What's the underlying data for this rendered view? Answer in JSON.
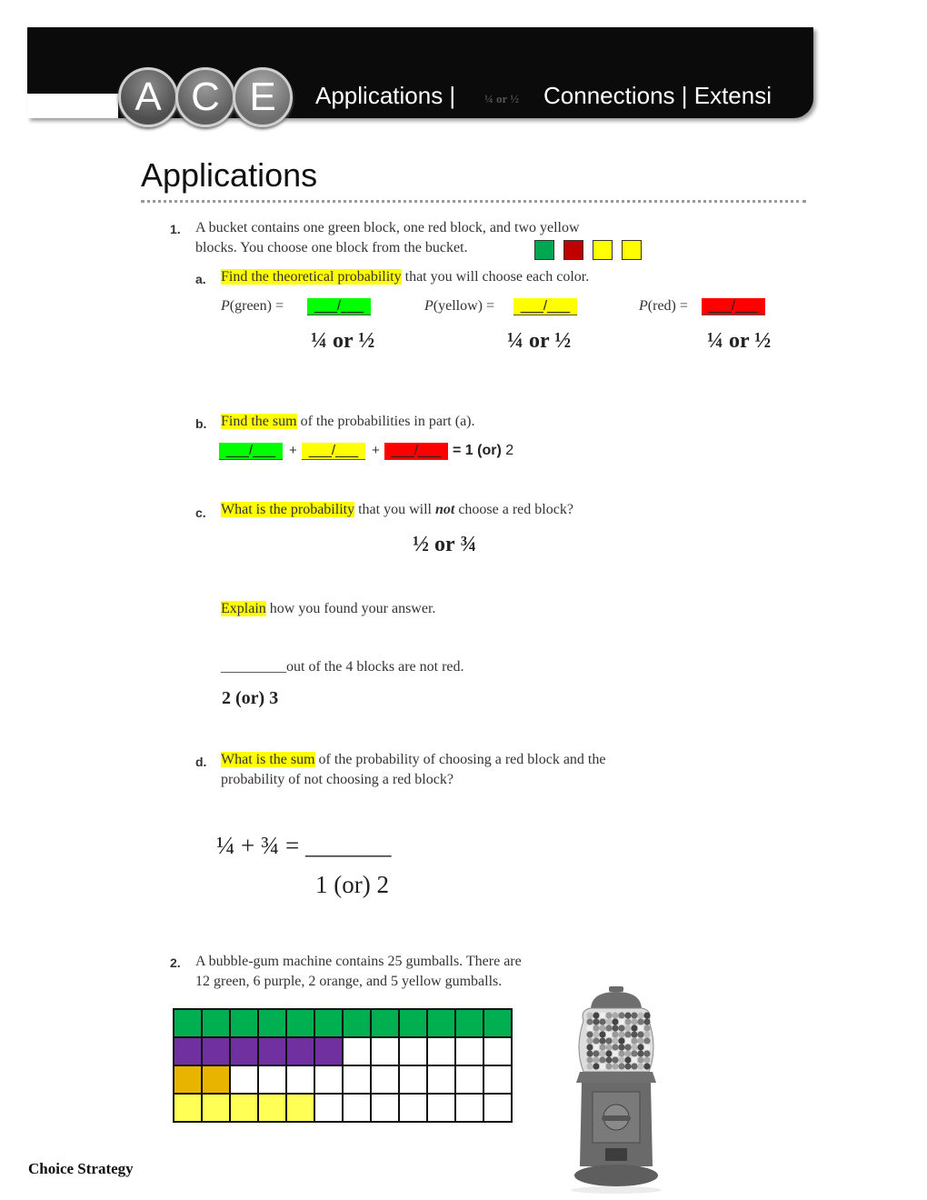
{
  "header": {
    "logo_letters": [
      "A",
      "C",
      "E"
    ],
    "nav_applications": "Applications |",
    "overlay_small": "¼ or ½",
    "nav_rest": "Connections | Extensi"
  },
  "section_title": "Applications",
  "problem1": {
    "number": "1.",
    "line1": "A bucket contains one green block, one red block, and two yellow",
    "line2": "blocks. You choose one block from the bucket.",
    "blocks": [
      {
        "color_name": "green",
        "hex": "#00a651"
      },
      {
        "color_name": "red",
        "hex": "#c00000"
      },
      {
        "color_name": "yellow",
        "hex": "#ffff00"
      },
      {
        "color_name": "yellow",
        "hex": "#ffff00"
      }
    ],
    "part_a": {
      "letter": "a.",
      "highlight": "Find the theoretical probability",
      "rest": " that you will choose each color.",
      "items": [
        {
          "label_italic": "P",
          "label_rest": "(green) =",
          "blank": "___/___",
          "fill": "#00ff00",
          "answer": "¼ or ½"
        },
        {
          "label_italic": "P",
          "label_rest": "(yellow) =",
          "blank": "___/___",
          "fill": "#ffff00",
          "answer": "¼ or ½"
        },
        {
          "label_italic": "P",
          "label_rest": "(red) =",
          "blank": "___/___",
          "fill": "#ff0000",
          "answer": "¼ or ½"
        }
      ]
    },
    "part_b": {
      "letter": "b.",
      "highlight": "Find the sum",
      "rest": " of the probabilities in part (a).",
      "blanks": [
        "___/___",
        "___/___",
        "___/___"
      ],
      "plus": "+",
      "equals_bold": "= 1 (or)",
      "equals_tail": " 2"
    },
    "part_c": {
      "letter": "c.",
      "highlight": "What is the probability",
      "rest_before": " that you will ",
      "emph": "not",
      "rest_after": " choose a red block?",
      "answer": "½ or ¾",
      "explain_highlight": "Explain",
      "explain_rest": " how you found your answer.",
      "fill_blank": "_________",
      "fill_text": "out of the 4 blocks are not red.",
      "fill_answer": "2 (or) 3"
    },
    "part_d": {
      "letter": "d.",
      "highlight": "What is the sum",
      "rest_line1": " of the probability of choosing a red block and the",
      "line2": "probability of not choosing a red block?",
      "equation": "¼ + ¾ =",
      "blank": "_______",
      "answer": "1 (or) 2"
    }
  },
  "problem2": {
    "number": "2.",
    "line1": "A bubble-gum machine contains 25 gumballs. There are",
    "line2": "12 green, 6 purple, 2 orange, and 5 yellow gumballs.",
    "grid": {
      "columns": 12,
      "rows": [
        {
          "color_name": "green",
          "hex": "#00b050",
          "count": 12
        },
        {
          "color_name": "purple",
          "hex": "#7030a0",
          "count": 6
        },
        {
          "color_name": "orange",
          "hex": "#e8b400",
          "count": 2
        },
        {
          "color_name": "yellow",
          "hex": "#ffff55",
          "count": 5
        }
      ]
    },
    "image": "gumball-machine"
  },
  "footer": "Choice Strategy"
}
